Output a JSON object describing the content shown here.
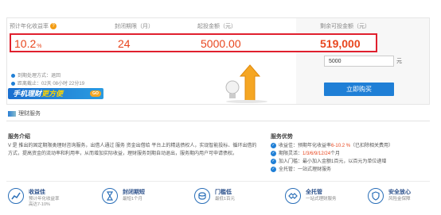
{
  "metrics": {
    "labels": {
      "rate": "预计年化收益率",
      "period": "封闭期限（月）",
      "min_amount": "起投金额（元）",
      "remaining": "剩余可投金额（元）"
    },
    "values": {
      "rate": "10.2",
      "rate_unit": "%",
      "period": "24",
      "min_amount": "5000.00",
      "remaining": "519,000"
    }
  },
  "purchase": {
    "amount_value": "5000",
    "unit": "元",
    "buy_label": "立即购买"
  },
  "info": {
    "expire_method": "到期处理方式：退回",
    "countdown": "距离截止：02天 08小时 22分19"
  },
  "promo": {
    "text_a": "手机理财",
    "text_b": "更方便",
    "go": "GO"
  },
  "fund_service": "理财服务",
  "intro": {
    "title": "服务介绍",
    "body": "V 是 推出的固定期限类理财咨询服务，出借人通过 服务 资金出借给 平台上的精选债权人，实现智能投标、循环出借的方式，提高资金的流动率和利用率，从而增加实际收益，理财服务到期自动退出，服务期内用户可申请债权。"
  },
  "advantages": {
    "title": "服务优势",
    "items": [
      {
        "prefix": "收益佳：预期年化收益率",
        "highlight": "6-10.2 %",
        "suffix": "（已扣除相关费用）"
      },
      {
        "prefix": "期限灵活：",
        "highlight": "1/3/6/9/12/24",
        "suffix": "个月"
      },
      {
        "prefix": "加入门槛：最小加入金额1百元，以百元为单位递增",
        "highlight": "",
        "suffix": ""
      },
      {
        "prefix": "全托管：一站式理财服务",
        "highlight": "",
        "suffix": ""
      }
    ]
  },
  "features": [
    {
      "title": "收益佳",
      "sub1": "预计年化收益率",
      "sub2": "高达7-10%",
      "icon": "trend-icon"
    },
    {
      "title": "封闭期短",
      "sub1": "最短1个月",
      "sub2": "",
      "icon": "hourglass-icon"
    },
    {
      "title": "门槛低",
      "sub1": "最低1百元",
      "sub2": "",
      "icon": "coin-icon"
    },
    {
      "title": "全托管",
      "sub1": "一站式理财服务",
      "sub2": "",
      "icon": "handshake-icon"
    },
    {
      "title": "安全放心",
      "sub1": "风险金保障",
      "sub2": "",
      "icon": "shield-icon"
    }
  ],
  "colors": {
    "accent_red": "#e8461e",
    "highlight_border": "#e0202e",
    "brand_blue": "#1f7fd6"
  }
}
